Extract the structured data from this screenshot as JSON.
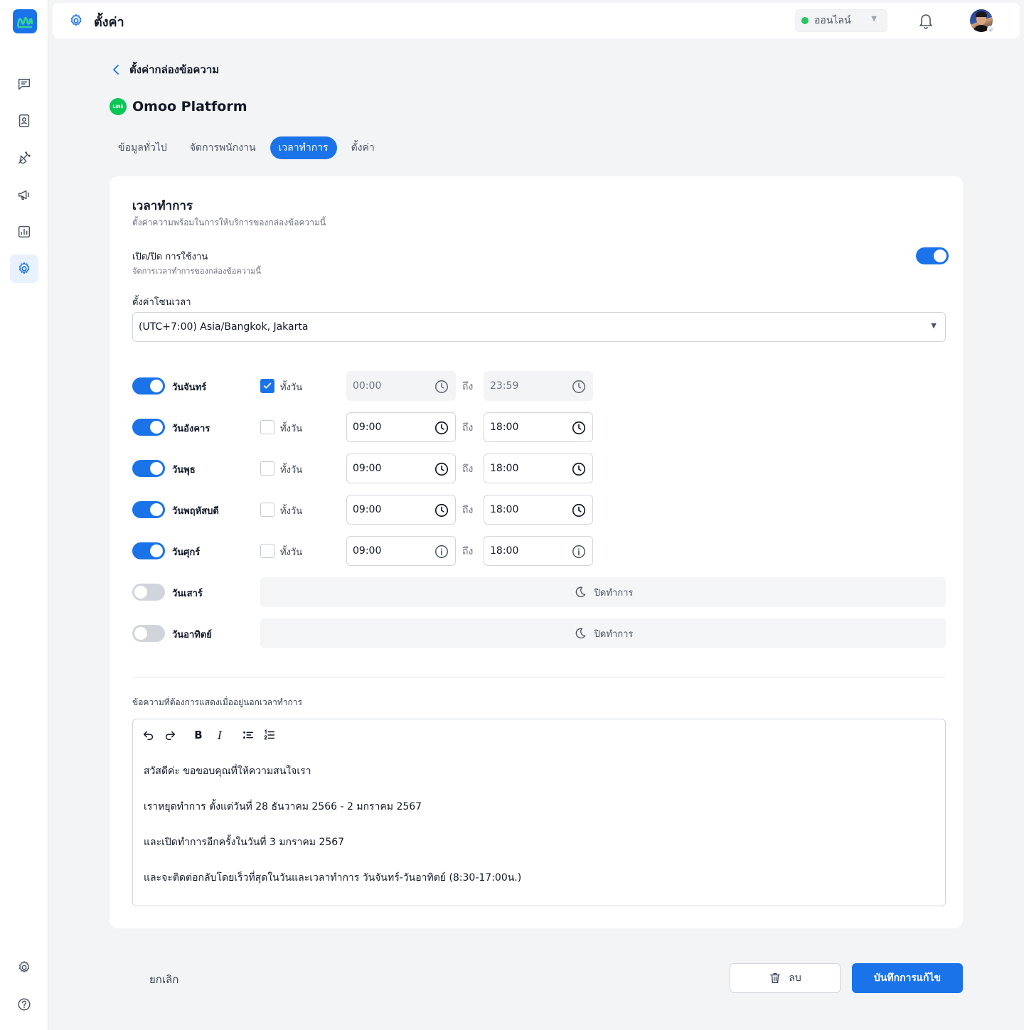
{
  "header": {
    "title": "ตั้งค่า",
    "status": "ออนไลน์",
    "icons": {
      "title": "gear-icon",
      "notifications": "bell-icon",
      "status_caret": "caret-down-icon"
    }
  },
  "sidebar": {
    "items": [
      {
        "icon": "chat-icon"
      },
      {
        "icon": "contacts-icon"
      },
      {
        "icon": "integration-plug-icon"
      },
      {
        "icon": "megaphone-icon"
      },
      {
        "icon": "analytics-chart-icon"
      },
      {
        "icon": "settings-gear-icon",
        "active": true
      }
    ],
    "bottom": [
      {
        "icon": "settings-gear-icon"
      },
      {
        "icon": "help-circle-icon"
      }
    ]
  },
  "breadcrumb": {
    "back_label": "ตั้งค่ากล่องข้อความ"
  },
  "channel": {
    "badge": "LINE",
    "name": "Omoo Platform",
    "color": "#06c755"
  },
  "tabs": [
    {
      "label": "ข้อมูลทั่วไป"
    },
    {
      "label": "จัดการพนักงาน"
    },
    {
      "label": "เวลาทำการ",
      "active": true
    },
    {
      "label": "ตั้งค่า"
    }
  ],
  "business_hours": {
    "title": "เวลาทำการ",
    "subtitle": "ตั้งค่าความพร้อมในการให้บริการของกล่องข้อความนี้",
    "enable_label": "เปิด/ปิด การใช้งาน",
    "enable_sub": "จัดการเวลาทำการของกล่องข้อความนี้",
    "enabled": true,
    "timezone_label": "ตั้งค่าโซนเวลา",
    "timezone_value": "(UTC+7:00) Asia/Bangkok, Jakarta",
    "all_day_label": "ทั้งวัน",
    "to_label": "ถึง",
    "closed_label": "ปิดทำการ",
    "days": [
      {
        "name": "วันจันทร์",
        "on": true,
        "all_day": true,
        "start": "00:00",
        "end": "23:59"
      },
      {
        "name": "วันอังคาร",
        "on": true,
        "all_day": false,
        "start": "09:00",
        "end": "18:00"
      },
      {
        "name": "วันพุธ",
        "on": true,
        "all_day": false,
        "start": "09:00",
        "end": "18:00"
      },
      {
        "name": "วันพฤหัสบดี",
        "on": true,
        "all_day": false,
        "start": "09:00",
        "end": "18:00"
      },
      {
        "name": "วันศุกร์",
        "on": true,
        "all_day": false,
        "start": "09:00",
        "end": "18:00"
      },
      {
        "name": "วันเสาร์",
        "on": false
      },
      {
        "name": "วันอาทิตย์",
        "on": false
      }
    ],
    "offline_message_label": "ข้อความที่ต้องการแสดงเมื่ออยู่นอกเวลาทำการ",
    "offline_message_lines": [
      "สวัสดีค่ะ ขอขอบคุณที่ให้ความสนใจเรา",
      "เราหยุดทำการ ตั้งแต่วันที่ 28 ธันวาคม 2566 - 2 มกราคม 2567",
      "และเปิดทำการอีกครั้งในวันที่ 3 มกราคม 2567",
      "และจะติดต่อกลับโดยเร็วที่สุดในวันและเวลาทำการ วันจันทร์-วันอาทิตย์ (8:30-17:00น.)"
    ],
    "editor_toolbar": {
      "bold": "B",
      "italic": "I",
      "icons": [
        "undo-icon",
        "redo-icon",
        "bullet-list-icon",
        "numbered-list-icon"
      ]
    }
  },
  "actions": {
    "cancel": "ยกเลิก",
    "delete": "ลบ",
    "save": "บันทึกการแก้ไข"
  },
  "colors": {
    "primary": "#1a73e8",
    "online": "#22c55e",
    "toggle_off": "#d1d5db"
  }
}
